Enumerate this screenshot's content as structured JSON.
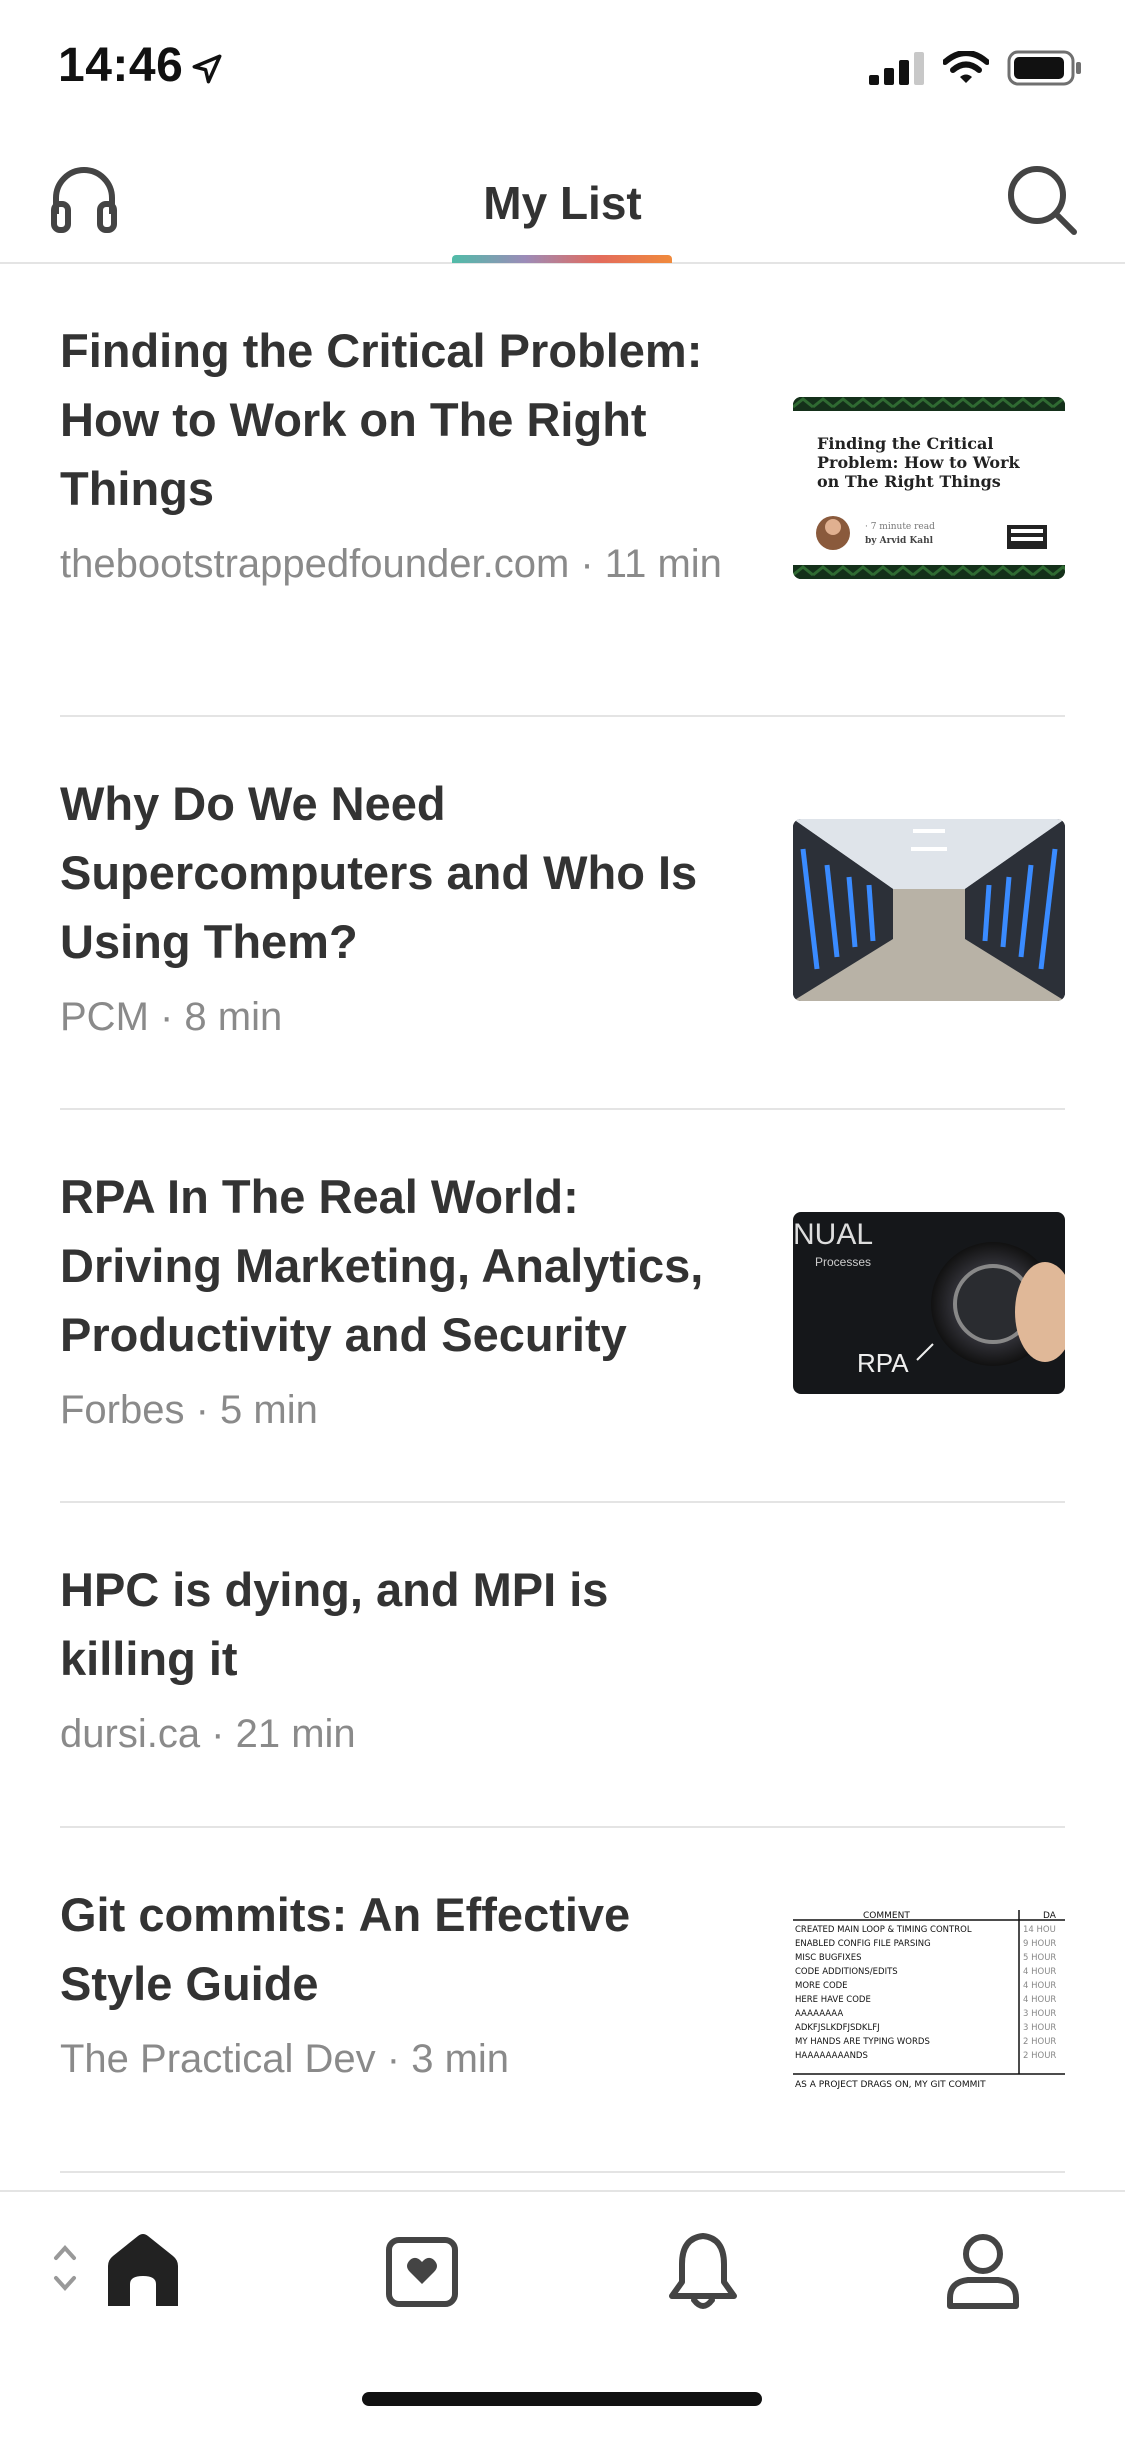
{
  "status": {
    "time": "14:46"
  },
  "header": {
    "title": "My List"
  },
  "articles": [
    {
      "title": "Finding the Critical Problem: How to Work on The Right Things",
      "meta": "thebootstrappedfounder.com · 11 min",
      "thumb": {
        "headline": "Finding the Critical Problem: How to Work on The Right Things",
        "read_time": "7 minute read",
        "author": "by Arvid Kahl"
      }
    },
    {
      "title": "Why Do We Need Supercomputers and Who Is Using Them?",
      "meta": "PCM · 8 min"
    },
    {
      "title": "RPA In The Real World: Driving Marketing, Analytics, Productivity and Security",
      "meta": "Forbes · 5 min",
      "thumb": {
        "top_text": "NUAL",
        "sub_text": "Processes",
        "dial_text": "RPA"
      }
    },
    {
      "title": "HPC is dying, and MPI is killing it",
      "meta": "dursi.ca · 21 min"
    },
    {
      "title": "Git commits: An Effective Style Guide",
      "meta": "The Practical Dev · 3 min",
      "thumb": {
        "col1": "COMMENT",
        "col2": "DA",
        "rows": [
          [
            "CREATED MAIN LOOP & TIMING CONTROL",
            "14 HOU"
          ],
          [
            "ENABLED CONFIG FILE PARSING",
            "9 HOUR"
          ],
          [
            "MISC BUGFIXES",
            "5 HOUR"
          ],
          [
            "CODE ADDITIONS/EDITS",
            "4 HOUR"
          ],
          [
            "MORE CODE",
            "4 HOUR"
          ],
          [
            "HERE HAVE CODE",
            "4 HOUR"
          ],
          [
            "AAAAAAAA",
            "3 HOUR"
          ],
          [
            "ADKFJSLKDFJSDKLFJ",
            "3 HOUR"
          ],
          [
            "MY HANDS ARE TYPING WORDS",
            "2 HOUR"
          ],
          [
            "HAAAAAAAANDS",
            "2 HOUR"
          ]
        ],
        "caption": "AS A PROJECT DRAGS ON, MY GIT COMMIT"
      }
    }
  ],
  "colors": {
    "accent_gradient": [
      "#50bca8",
      "#9c8bb8",
      "#e36b5c",
      "#f08a3c"
    ],
    "text": "#333333",
    "meta": "#8a8a8a"
  }
}
